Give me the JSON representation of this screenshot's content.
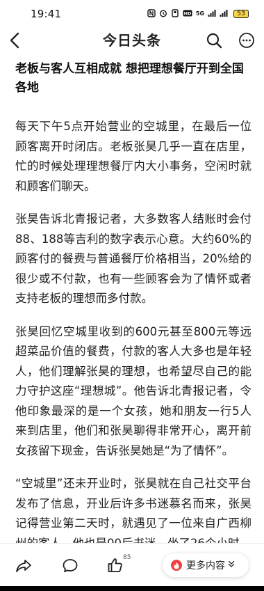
{
  "status_bar": {
    "time": "19:41",
    "network_label": "5G",
    "battery_level": "53",
    "icons": [
      "nfc-icon",
      "alarm-icon",
      "dnd-icon",
      "hd-icon",
      "signal-icon",
      "signal-icon",
      "battery-icon"
    ]
  },
  "header": {
    "title": "今日头条",
    "back_icon": "chevron-left-icon",
    "search_icon": "search-icon",
    "more_icon": "more-icon"
  },
  "article": {
    "title": "老板与客人互相成就 想把理想餐厅开到全国各地",
    "paragraphs": [
      "每天下午5点开始营业的空城里，在最后一位顾客离开时闭店。老板张昊几乎一直在店里，忙的时候处理理想餐厅内大小事务，空闲时就和顾客们聊天。",
      "张昊告诉北青报记者，大多数客人结账时会付88、188等吉利的数字表示心意。大约60%的顾客付的餐费与普通餐厅价格相当，20%给的很少或不付款，也有一些顾客会为了情怀或者支持老板的理想而多付款。",
      "张昊回忆空城里收到的600元甚至800元等远超菜品价值的餐费，付款的客人大多也是年轻人，他们理解张昊的理想，也希望尽自己的能力守护这座“理想城”。他告诉北青报记者，令他印象最深的是一个女孩，她和朋友一行5人来到店里，他们和张昊聊得非常开心，离开前女孩留下现金，告诉张昊她是“为了情怀”。",
      "“空城里”还未开业时，张昊就在自己社交平台发布了信息，开业后许多书迷慕名而来，张昊记得营业第二天时，就遇见了一位来自广西柳州的客人，他也是00后书迷，坐了26个小时"
    ]
  },
  "bottom_bar": {
    "like_count": "85",
    "more_content_label": "更多内容",
    "icons": [
      "share-icon",
      "comment-icon",
      "thumbs-up-icon",
      "flame-icon",
      "chevron-double-down-icon"
    ]
  },
  "colors": {
    "accent": "#f04142",
    "text": "#222222",
    "background": "#ffffff",
    "battery": "#f5d34a"
  }
}
